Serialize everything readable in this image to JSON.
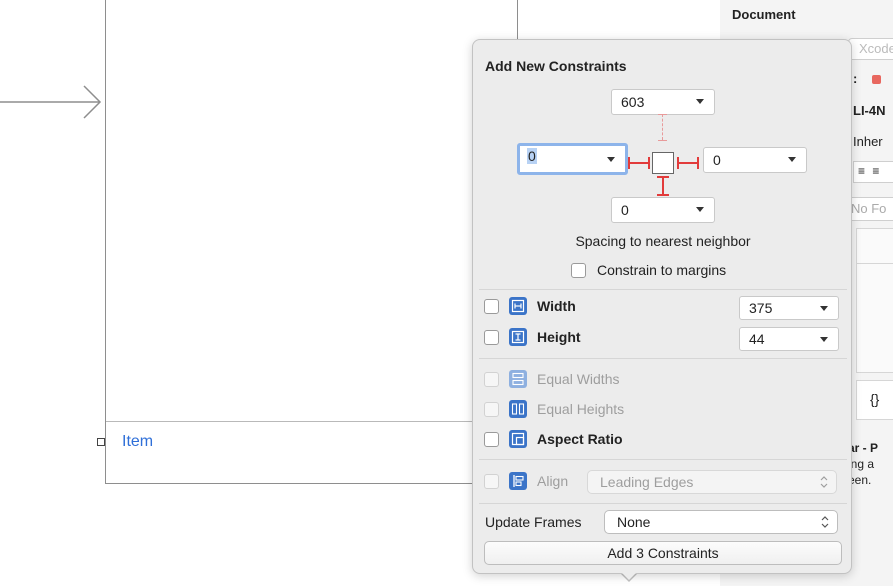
{
  "canvas": {
    "tab_item_label": "Item"
  },
  "inspector": {
    "title": "Document",
    "label_field_placeholder": "Xcode",
    "colon": ":",
    "id_text": "LI-4N",
    "inherit_text": "Inher",
    "align_text": "≡ ≡",
    "font_placeholder": "No Fo",
    "braces": "{}",
    "desc_line1": "ar - P",
    "desc_line2": "ing a",
    "desc_line3": "een."
  },
  "popover": {
    "title": "Add New Constraints",
    "top_value": "603",
    "left_value": "0",
    "right_value": "0",
    "bottom_value": "0",
    "spacing_label": "Spacing to nearest neighbor",
    "constrain_margins_label": "Constrain to margins",
    "width_label": "Width",
    "width_value": "375",
    "height_label": "Height",
    "height_value": "44",
    "equal_widths_label": "Equal Widths",
    "equal_heights_label": "Equal Heights",
    "aspect_ratio_label": "Aspect Ratio",
    "align_label": "Align",
    "align_value": "Leading Edges",
    "update_frames_label": "Update Frames",
    "update_frames_value": "None",
    "add_button_label": "Add 3 Constraints"
  },
  "colors": {
    "pin_red": "#e23b3b",
    "icon_blue": "#3b74c8",
    "focus_ring": "#8db4ea",
    "link_blue": "#2f6fd8"
  }
}
